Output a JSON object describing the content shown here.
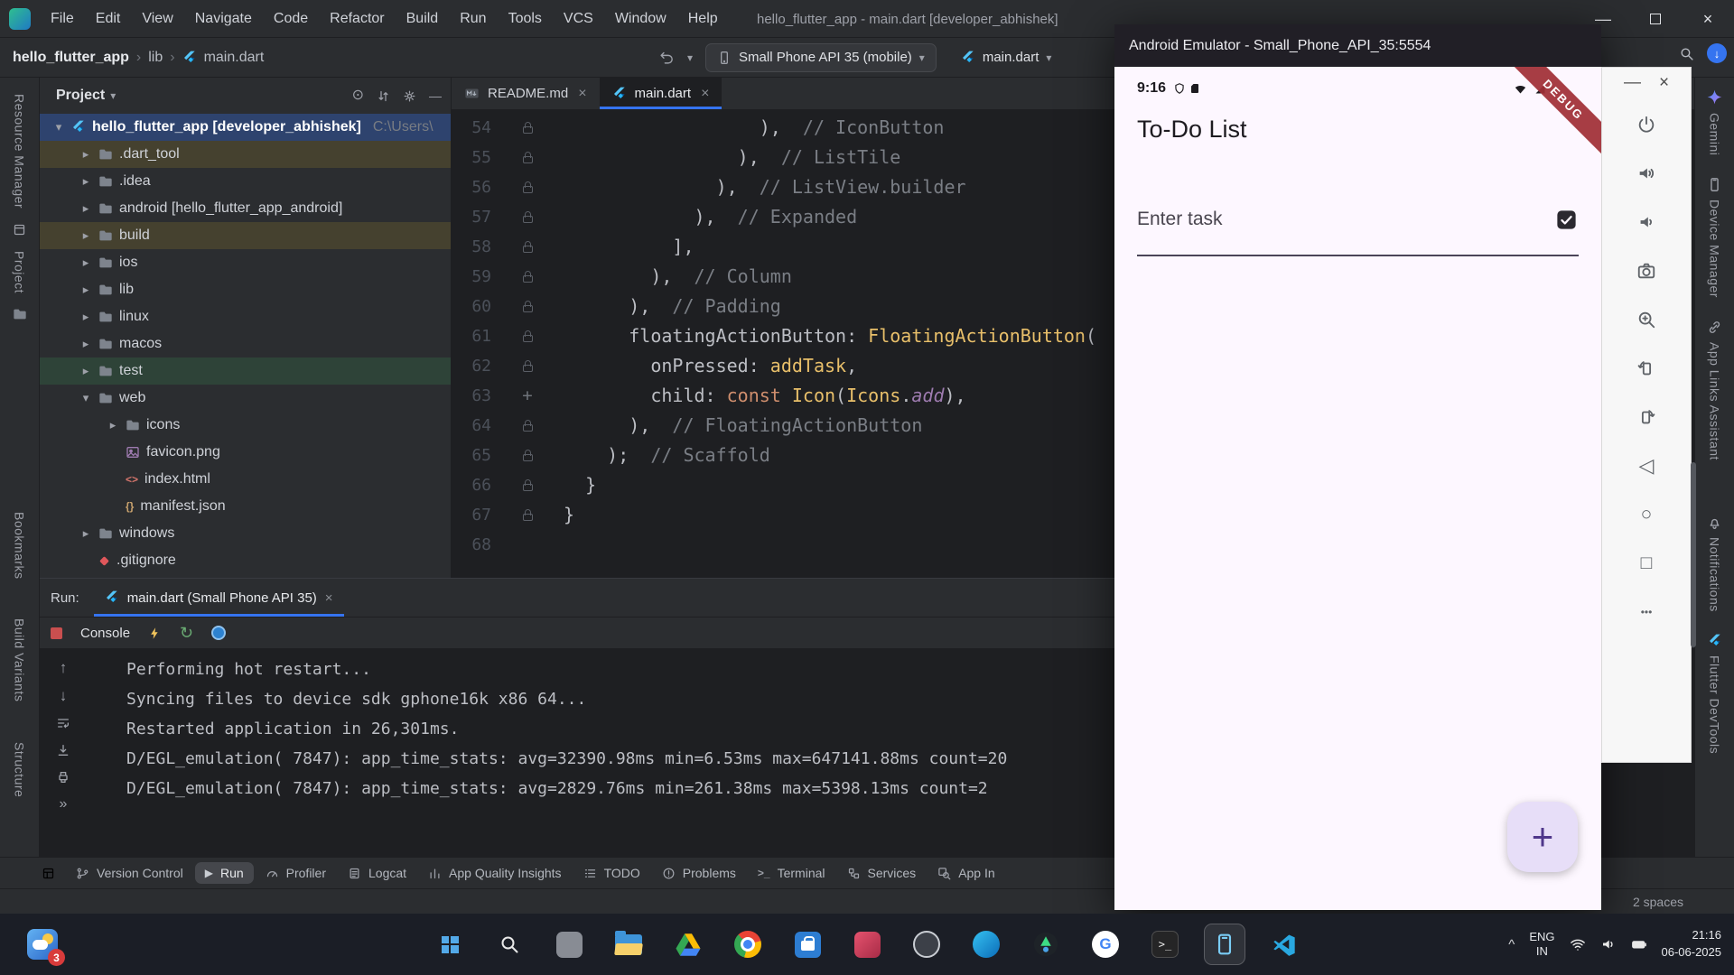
{
  "titlebar": {
    "title": "hello_flutter_app - main.dart [developer_abhishek]",
    "menus": [
      "File",
      "Edit",
      "View",
      "Navigate",
      "Code",
      "Refactor",
      "Build",
      "Run",
      "Tools",
      "VCS",
      "Window",
      "Help"
    ]
  },
  "toolbar": {
    "breadcrumb": [
      "hello_flutter_app",
      "lib",
      "main.dart"
    ],
    "device_selector": "Small Phone API 35 (mobile)",
    "run_config": "main.dart"
  },
  "left_strip": {
    "top": [
      "Resource Manager",
      "Project"
    ],
    "bottom": [
      "Bookmarks",
      "Build Variants",
      "Structure"
    ]
  },
  "right_strip": [
    {
      "icon": "gemini-star",
      "label": "Gemini"
    },
    {
      "icon": "device-phone",
      "label": "Device Manager"
    },
    {
      "icon": "app-links",
      "label": "App Links Assistant"
    },
    {
      "icon": "bell",
      "label": "Notifications"
    },
    {
      "icon": "flutter",
      "label": "Flutter DevTools"
    }
  ],
  "project_panel": {
    "title": "Project",
    "tree": [
      {
        "label": "hello_flutter_app [developer_abhishek]",
        "suffix": "C:\\Users\\",
        "depth": 0,
        "chev": "down",
        "icon": "flutter",
        "state": "sel"
      },
      {
        "label": ".dart_tool",
        "depth": 1,
        "chev": "right",
        "icon": "folder",
        "state": "excl"
      },
      {
        "label": ".idea",
        "depth": 1,
        "chev": "right",
        "icon": "folder"
      },
      {
        "label": "android [hello_flutter_app_android]",
        "depth": 1,
        "chev": "right",
        "icon": "folder"
      },
      {
        "label": "build",
        "depth": 1,
        "chev": "right",
        "icon": "folder",
        "state": "excl"
      },
      {
        "label": "ios",
        "depth": 1,
        "chev": "right",
        "icon": "folder"
      },
      {
        "label": "lib",
        "depth": 1,
        "chev": "right",
        "icon": "folder"
      },
      {
        "label": "linux",
        "depth": 1,
        "chev": "right",
        "icon": "folder"
      },
      {
        "label": "macos",
        "depth": 1,
        "chev": "right",
        "icon": "folder"
      },
      {
        "label": "test",
        "depth": 1,
        "chev": "right",
        "icon": "folder",
        "state": "test"
      },
      {
        "label": "web",
        "depth": 1,
        "chev": "down",
        "icon": "folder"
      },
      {
        "label": "icons",
        "depth": 2,
        "chev": "right",
        "icon": "folder"
      },
      {
        "label": "favicon.png",
        "depth": 2,
        "icon": "image"
      },
      {
        "label": "index.html",
        "depth": 2,
        "icon": "html"
      },
      {
        "label": "manifest.json",
        "depth": 2,
        "icon": "json"
      },
      {
        "label": "windows",
        "depth": 1,
        "chev": "right",
        "icon": "folder"
      },
      {
        "label": ".gitignore",
        "depth": 1,
        "icon": "git"
      }
    ]
  },
  "editor": {
    "tabs": [
      {
        "icon": "markdown",
        "label": "README.md",
        "active": false
      },
      {
        "icon": "flutter",
        "label": "main.dart",
        "active": true
      }
    ],
    "lines": [
      {
        "n": "54",
        "ind": 18,
        "gut": "lock",
        "tok": [
          {
            "t": "),  ",
            "s": "p"
          },
          {
            "t": "// IconButton",
            "s": "c"
          }
        ]
      },
      {
        "n": "55",
        "ind": 16,
        "gut": "lock",
        "tok": [
          {
            "t": "),  ",
            "s": "p"
          },
          {
            "t": "// ListTile",
            "s": "c"
          }
        ]
      },
      {
        "n": "56",
        "ind": 14,
        "gut": "lock",
        "tok": [
          {
            "t": "),  ",
            "s": "p"
          },
          {
            "t": "// ListView.builder",
            "s": "c"
          }
        ]
      },
      {
        "n": "57",
        "ind": 12,
        "gut": "lock",
        "tok": [
          {
            "t": "),  ",
            "s": "p"
          },
          {
            "t": "// Expanded",
            "s": "c"
          }
        ]
      },
      {
        "n": "58",
        "ind": 10,
        "gut": "lock",
        "tok": [
          {
            "t": "],",
            "s": "p"
          }
        ]
      },
      {
        "n": "59",
        "ind": 8,
        "gut": "lock",
        "tok": [
          {
            "t": "),  ",
            "s": "p"
          },
          {
            "t": "// Column",
            "s": "c"
          }
        ]
      },
      {
        "n": "60",
        "ind": 6,
        "gut": "lock",
        "tok": [
          {
            "t": "),  ",
            "s": "p"
          },
          {
            "t": "// Padding",
            "s": "c"
          }
        ]
      },
      {
        "n": "61",
        "ind": 6,
        "gut": "lock",
        "tok": [
          {
            "t": "floatingActionButton: ",
            "s": "p"
          },
          {
            "t": "FloatingActionButton",
            "s": "f"
          },
          {
            "t": "(",
            "s": "p"
          }
        ]
      },
      {
        "n": "62",
        "ind": 8,
        "gut": "lock",
        "tok": [
          {
            "t": "onPressed: ",
            "s": "p"
          },
          {
            "t": "addTask",
            "s": "f"
          },
          {
            "t": ",",
            "s": "p"
          }
        ]
      },
      {
        "n": "63",
        "ind": 8,
        "gut": "plus",
        "tok": [
          {
            "t": "child: ",
            "s": "p"
          },
          {
            "t": "const ",
            "s": "k"
          },
          {
            "t": "Icon",
            "s": "f"
          },
          {
            "t": "(",
            "s": "p"
          },
          {
            "t": "Icons",
            "s": "f"
          },
          {
            "t": ".",
            "s": "p"
          },
          {
            "t": "add",
            "s": "m"
          },
          {
            "t": "),",
            "s": "p"
          }
        ]
      },
      {
        "n": "64",
        "ind": 6,
        "gut": "lock",
        "tok": [
          {
            "t": "),  ",
            "s": "p"
          },
          {
            "t": "// FloatingActionButton",
            "s": "c"
          }
        ]
      },
      {
        "n": "65",
        "ind": 4,
        "gut": "lock",
        "tok": [
          {
            "t": ");  ",
            "s": "p"
          },
          {
            "t": "// Scaffold",
            "s": "c"
          }
        ]
      },
      {
        "n": "66",
        "ind": 2,
        "gut": "lock",
        "tok": [
          {
            "t": "}",
            "s": "p"
          }
        ]
      },
      {
        "n": "67",
        "ind": 0,
        "gut": "lock",
        "tok": [
          {
            "t": "}",
            "s": "p"
          }
        ]
      },
      {
        "n": "68",
        "ind": 0,
        "gut": "none",
        "tok": []
      }
    ]
  },
  "run_panel": {
    "label": "Run:",
    "tab_label": "main.dart (Small Phone API 35)",
    "console_tab": "Console",
    "output": [
      "Performing hot restart...",
      "Syncing files to device sdk gphone16k x86 64...",
      "Restarted application in 26,301ms.",
      "D/EGL_emulation( 7847): app_time_stats: avg=32390.98ms min=6.53ms max=647141.88ms count=20",
      "D/EGL_emulation( 7847): app_time_stats: avg=2829.76ms min=261.38ms max=5398.13ms count=2"
    ]
  },
  "bottom_bar": {
    "items": [
      {
        "icon": "branch",
        "label": "Version Control"
      },
      {
        "icon": "play",
        "label": "Run",
        "active": true
      },
      {
        "icon": "gauge",
        "label": "Profiler"
      },
      {
        "icon": "logcat",
        "label": "Logcat"
      },
      {
        "icon": "insights",
        "label": "App Quality Insights"
      },
      {
        "icon": "todo",
        "label": "TODO"
      },
      {
        "icon": "problems",
        "label": "Problems"
      },
      {
        "icon": "terminal",
        "label": "Terminal"
      },
      {
        "icon": "services",
        "label": "Services"
      },
      {
        "icon": "inspect",
        "label": "App In"
      }
    ]
  },
  "status_bar": {
    "right": "2 spaces"
  },
  "emulator": {
    "window_title": "Android Emulator - Small_Phone_API_35:5554",
    "status_time": "9:16",
    "debug_banner": "DEBUG",
    "app_title": "To-Do List",
    "input_placeholder": "Enter task",
    "fab_glyph": "+",
    "side_buttons": [
      "power",
      "volume-up",
      "volume-down",
      "camera",
      "zoom",
      "rotate-left",
      "rotate-right",
      "back",
      "home",
      "overview",
      "more"
    ]
  },
  "taskbar": {
    "badge": "3",
    "apps": [
      {
        "name": "start"
      },
      {
        "name": "search"
      },
      {
        "name": "app-gray"
      },
      {
        "name": "explorer"
      },
      {
        "name": "drive"
      },
      {
        "name": "chrome"
      },
      {
        "name": "store"
      },
      {
        "name": "app-red"
      },
      {
        "name": "app-circle"
      },
      {
        "name": "edge"
      },
      {
        "name": "android-studio"
      },
      {
        "name": "google"
      },
      {
        "name": "terminal-app"
      },
      {
        "name": "emulator",
        "active": true
      },
      {
        "name": "vscode"
      }
    ],
    "tray": {
      "chevron": "^",
      "lang_top": "ENG",
      "lang_bottom": "IN",
      "time": "21:16",
      "date": "06-06-2025"
    }
  }
}
